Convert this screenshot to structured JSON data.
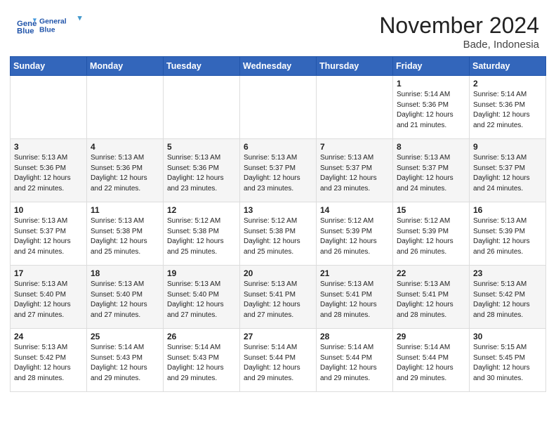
{
  "header": {
    "logo_line1": "General",
    "logo_line2": "Blue",
    "month": "November 2024",
    "location": "Bade, Indonesia"
  },
  "days_of_week": [
    "Sunday",
    "Monday",
    "Tuesday",
    "Wednesday",
    "Thursday",
    "Friday",
    "Saturday"
  ],
  "weeks": [
    [
      {
        "day": "",
        "info": ""
      },
      {
        "day": "",
        "info": ""
      },
      {
        "day": "",
        "info": ""
      },
      {
        "day": "",
        "info": ""
      },
      {
        "day": "",
        "info": ""
      },
      {
        "day": "1",
        "info": "Sunrise: 5:14 AM\nSunset: 5:36 PM\nDaylight: 12 hours\nand 21 minutes."
      },
      {
        "day": "2",
        "info": "Sunrise: 5:14 AM\nSunset: 5:36 PM\nDaylight: 12 hours\nand 22 minutes."
      }
    ],
    [
      {
        "day": "3",
        "info": "Sunrise: 5:13 AM\nSunset: 5:36 PM\nDaylight: 12 hours\nand 22 minutes."
      },
      {
        "day": "4",
        "info": "Sunrise: 5:13 AM\nSunset: 5:36 PM\nDaylight: 12 hours\nand 22 minutes."
      },
      {
        "day": "5",
        "info": "Sunrise: 5:13 AM\nSunset: 5:36 PM\nDaylight: 12 hours\nand 23 minutes."
      },
      {
        "day": "6",
        "info": "Sunrise: 5:13 AM\nSunset: 5:37 PM\nDaylight: 12 hours\nand 23 minutes."
      },
      {
        "day": "7",
        "info": "Sunrise: 5:13 AM\nSunset: 5:37 PM\nDaylight: 12 hours\nand 23 minutes."
      },
      {
        "day": "8",
        "info": "Sunrise: 5:13 AM\nSunset: 5:37 PM\nDaylight: 12 hours\nand 24 minutes."
      },
      {
        "day": "9",
        "info": "Sunrise: 5:13 AM\nSunset: 5:37 PM\nDaylight: 12 hours\nand 24 minutes."
      }
    ],
    [
      {
        "day": "10",
        "info": "Sunrise: 5:13 AM\nSunset: 5:37 PM\nDaylight: 12 hours\nand 24 minutes."
      },
      {
        "day": "11",
        "info": "Sunrise: 5:13 AM\nSunset: 5:38 PM\nDaylight: 12 hours\nand 25 minutes."
      },
      {
        "day": "12",
        "info": "Sunrise: 5:12 AM\nSunset: 5:38 PM\nDaylight: 12 hours\nand 25 minutes."
      },
      {
        "day": "13",
        "info": "Sunrise: 5:12 AM\nSunset: 5:38 PM\nDaylight: 12 hours\nand 25 minutes."
      },
      {
        "day": "14",
        "info": "Sunrise: 5:12 AM\nSunset: 5:39 PM\nDaylight: 12 hours\nand 26 minutes."
      },
      {
        "day": "15",
        "info": "Sunrise: 5:12 AM\nSunset: 5:39 PM\nDaylight: 12 hours\nand 26 minutes."
      },
      {
        "day": "16",
        "info": "Sunrise: 5:13 AM\nSunset: 5:39 PM\nDaylight: 12 hours\nand 26 minutes."
      }
    ],
    [
      {
        "day": "17",
        "info": "Sunrise: 5:13 AM\nSunset: 5:40 PM\nDaylight: 12 hours\nand 27 minutes."
      },
      {
        "day": "18",
        "info": "Sunrise: 5:13 AM\nSunset: 5:40 PM\nDaylight: 12 hours\nand 27 minutes."
      },
      {
        "day": "19",
        "info": "Sunrise: 5:13 AM\nSunset: 5:40 PM\nDaylight: 12 hours\nand 27 minutes."
      },
      {
        "day": "20",
        "info": "Sunrise: 5:13 AM\nSunset: 5:41 PM\nDaylight: 12 hours\nand 27 minutes."
      },
      {
        "day": "21",
        "info": "Sunrise: 5:13 AM\nSunset: 5:41 PM\nDaylight: 12 hours\nand 28 minutes."
      },
      {
        "day": "22",
        "info": "Sunrise: 5:13 AM\nSunset: 5:41 PM\nDaylight: 12 hours\nand 28 minutes."
      },
      {
        "day": "23",
        "info": "Sunrise: 5:13 AM\nSunset: 5:42 PM\nDaylight: 12 hours\nand 28 minutes."
      }
    ],
    [
      {
        "day": "24",
        "info": "Sunrise: 5:13 AM\nSunset: 5:42 PM\nDaylight: 12 hours\nand 28 minutes."
      },
      {
        "day": "25",
        "info": "Sunrise: 5:14 AM\nSunset: 5:43 PM\nDaylight: 12 hours\nand 29 minutes."
      },
      {
        "day": "26",
        "info": "Sunrise: 5:14 AM\nSunset: 5:43 PM\nDaylight: 12 hours\nand 29 minutes."
      },
      {
        "day": "27",
        "info": "Sunrise: 5:14 AM\nSunset: 5:44 PM\nDaylight: 12 hours\nand 29 minutes."
      },
      {
        "day": "28",
        "info": "Sunrise: 5:14 AM\nSunset: 5:44 PM\nDaylight: 12 hours\nand 29 minutes."
      },
      {
        "day": "29",
        "info": "Sunrise: 5:14 AM\nSunset: 5:44 PM\nDaylight: 12 hours\nand 29 minutes."
      },
      {
        "day": "30",
        "info": "Sunrise: 5:15 AM\nSunset: 5:45 PM\nDaylight: 12 hours\nand 30 minutes."
      }
    ]
  ]
}
